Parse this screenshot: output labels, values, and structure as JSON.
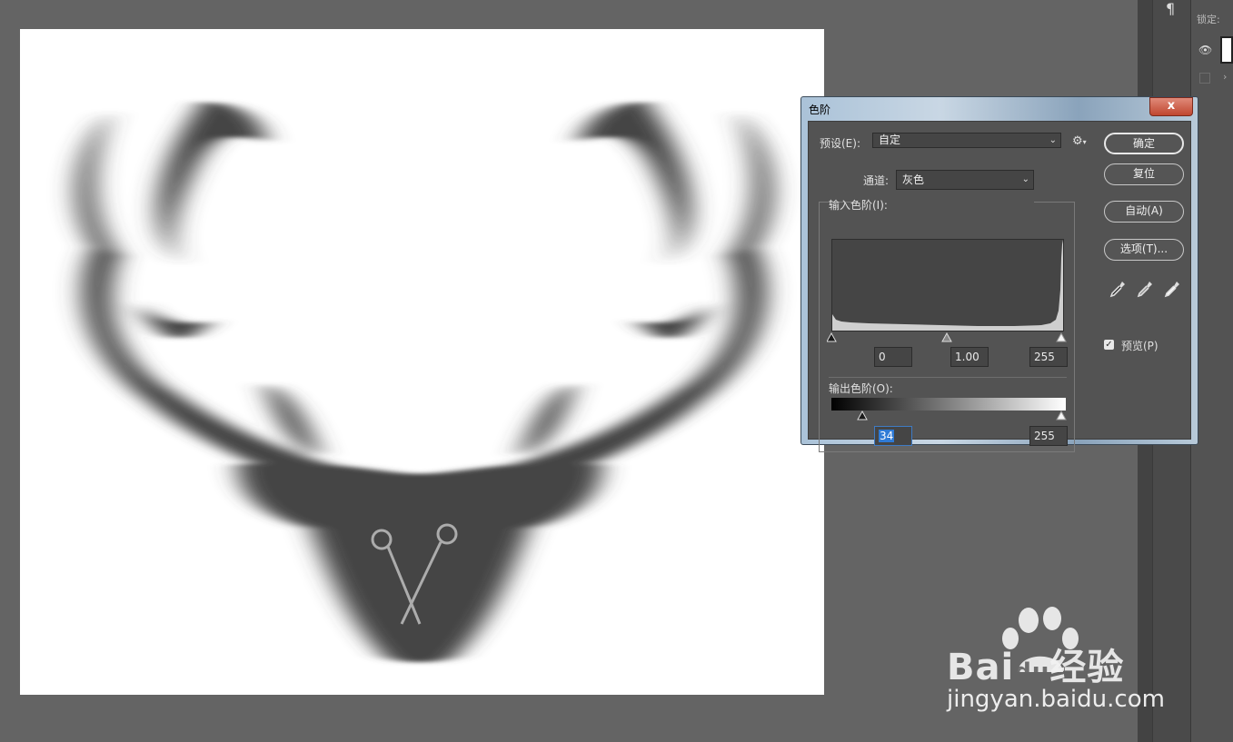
{
  "dialog": {
    "title": "色阶",
    "close_glyph": "x",
    "preset_label": "预设(E):",
    "preset_value": "自定",
    "channel_label": "通道:",
    "channel_value": "灰色",
    "input_levels_label": "输入色阶(I):",
    "input_black": "0",
    "input_gamma": "1.00",
    "input_white": "255",
    "output_levels_label": "输出色阶(O):",
    "output_black": "34",
    "output_white": "255",
    "buttons": {
      "ok": "确定",
      "reset": "复位",
      "auto": "自动(A)",
      "options": "选项(T)..."
    },
    "preview_label": "预览(P)",
    "preview_checked": true,
    "icons": [
      "gear-icon",
      "black-eyedropper-icon",
      "gray-eyedropper-icon",
      "white-eyedropper-icon"
    ]
  },
  "right_panel": {
    "paragraph_glyph": "¶",
    "lock_label": "锁定:"
  },
  "watermark": {
    "brand": "Bai",
    "brand_paw": "du",
    "brand_suffix": "经验",
    "url": "jingyan.baidu.com"
  },
  "colors": {
    "workspace": "#646464",
    "dialog_body": "#535353",
    "title_bar": "#aac2d8",
    "close_button": "#c0462f",
    "selection": "#2f7bd6"
  }
}
